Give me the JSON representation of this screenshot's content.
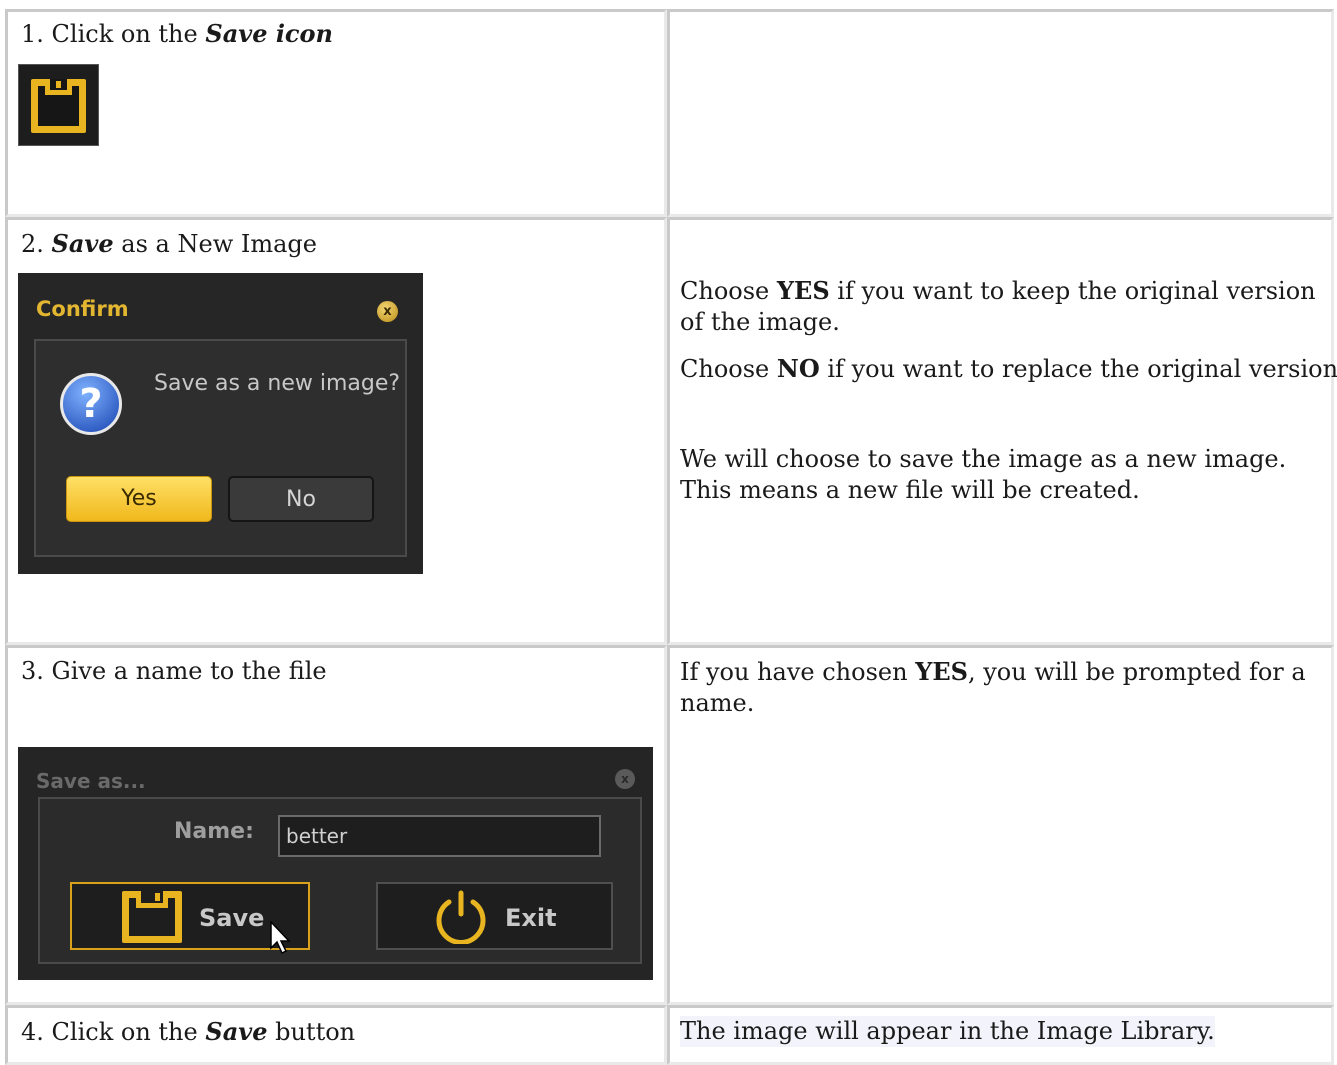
{
  "steps": [
    {
      "left": {
        "num": "1.",
        "pre": "Click on the",
        "em": "Save icon",
        "post": ""
      },
      "right": {}
    },
    {
      "left": {
        "num": "2.",
        "pre": "",
        "em": "Save",
        "post": "as a New Image"
      },
      "right": {
        "p1_pre": "Choose",
        "p1_bold": "YES",
        "p1_post": "if you want to keep the original version of the image.",
        "p2_pre": "Choose",
        "p2_bold": "NO",
        "p2_post": "if you want to replace the original version.",
        "p3": "We will choose to save the image as a new image. This means a new file will be created."
      }
    },
    {
      "left": {
        "num": "3.",
        "text": "Give a name to the file"
      },
      "right": {
        "pre": "If you have chosen",
        "bold": "YES",
        "post": ", you will be prompted for a name."
      }
    },
    {
      "left": {
        "num": "4.",
        "pre": "Click on the",
        "em": "Save",
        "post": "button"
      },
      "right": {
        "text": "The image will appear in the Image Library."
      }
    }
  ],
  "confirm_dialog": {
    "title": "Confirm",
    "close": "x",
    "message": "Save as a new image?",
    "yes_label": "Yes",
    "no_label": "No"
  },
  "saveas_dialog": {
    "title": "Save as...",
    "close": "x",
    "name_label": "Name:",
    "name_value": "better",
    "save_label": "Save",
    "exit_label": "Exit"
  },
  "colors": {
    "accent_yellow": "#f0b81c",
    "dialog_bg": "#262626",
    "cell_border": "#c9c9c9"
  },
  "icons": [
    "save-icon",
    "question-icon",
    "close-icon",
    "power-icon",
    "cursor-icon"
  ]
}
